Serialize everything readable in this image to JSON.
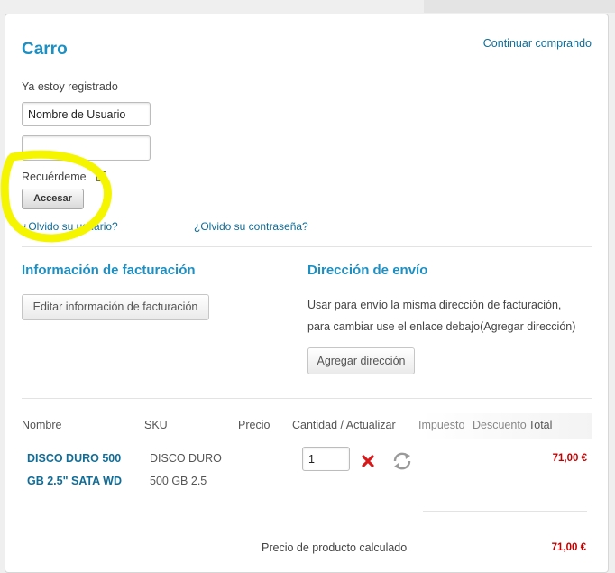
{
  "header": {
    "title": "Carro",
    "continue_label": "Continuar comprando"
  },
  "login": {
    "registered_label": "Ya estoy registrado",
    "username_value": "Nombre de Usuario",
    "password_value": "",
    "remember_label": "Recuérdeme",
    "login_button": "Accesar",
    "forgot_user": "¿Olvido su usuario?",
    "forgot_password": "¿Olvido su contraseña?"
  },
  "billing": {
    "heading": "Información de facturación",
    "edit_button": "Editar información de facturación"
  },
  "shipping": {
    "heading": "Dirección de envío",
    "note_line1": "Usar para envío la misma dirección de facturación,",
    "note_line2": "para cambiar use el enlace debajo(Agregar dirección)",
    "add_button": "Agregar dirección"
  },
  "table": {
    "headers": {
      "name": "Nombre",
      "sku": "SKU",
      "price": "Precio",
      "qty": "Cantidad / Actualizar",
      "tax": "Impuesto",
      "discount": "Descuento",
      "total": "Total"
    },
    "rows": [
      {
        "name_line1": "DISCO DURO 500",
        "name_line2": "GB 2.5\" SATA WD",
        "sku_line1": "DISCO DURO",
        "sku_line2": "500 GB 2.5",
        "qty": "1",
        "total": "71,00 €"
      }
    ]
  },
  "summary": {
    "label": "Precio de producto calculado",
    "value": "71,00 €"
  },
  "icons": {
    "remove": "remove-icon",
    "update": "refresh-icon"
  },
  "colors": {
    "accent": "#1d8fc2",
    "link": "#106d97",
    "price": "#c00000",
    "highlight": "#f5f500"
  }
}
